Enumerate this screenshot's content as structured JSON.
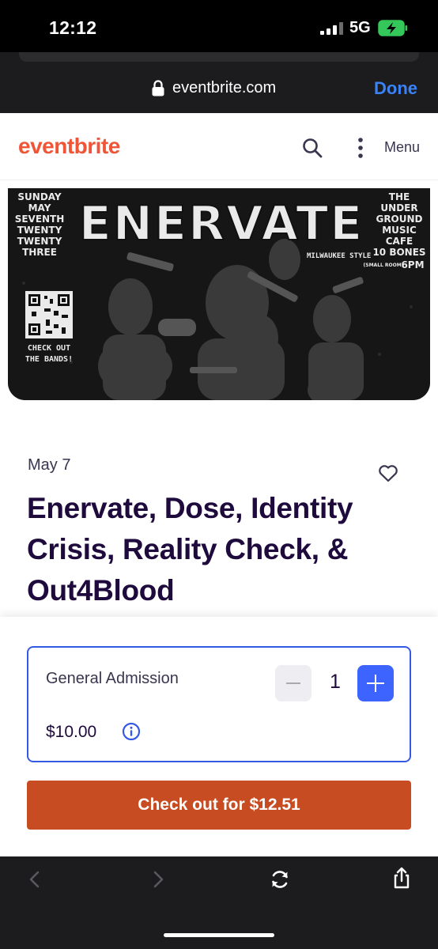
{
  "status_bar": {
    "time": "12:12",
    "network": "5G"
  },
  "safari": {
    "url": "eventbrite.com",
    "done_label": "Done"
  },
  "site_nav": {
    "logo": "eventbrite",
    "menu_label": "Menu"
  },
  "banner": {
    "headline": "ENERVATE",
    "left_text": [
      "SUNDAY",
      "MAY",
      "SEVENTH",
      "TWENTY",
      "TWENTY",
      "THREE"
    ],
    "right_text": [
      "THE",
      "UNDER",
      "GROUND",
      "MUSIC",
      "CAFE",
      "10 BONES",
      "(SMALL ROOM)",
      "6PM"
    ],
    "tagline": "MILWAUKEE STYLE",
    "qr_caption": [
      "CHECK OUT",
      "THE BANDS!"
    ]
  },
  "event": {
    "date": "May 7",
    "title_lines": [
      "Enervate, Dose, Identity",
      "Crisis, Reality Check, &",
      "Out4Blood"
    ]
  },
  "ticket": {
    "name": "General Admission",
    "price": "$10.00",
    "quantity": "1"
  },
  "checkout": {
    "label": "Check out for $12.51"
  },
  "colors": {
    "brand_orange": "#f05537",
    "checkout_button": "#c84c21",
    "accent_blue": "#3d64ff",
    "title_navy": "#1e0a3c",
    "safari_blue": "#3a82f7"
  },
  "icons": [
    "lock-icon",
    "search-icon",
    "kebab-icon",
    "heart-icon",
    "info-icon",
    "minus-icon",
    "plus-icon",
    "back-icon",
    "forward-icon",
    "reload-icon",
    "share-icon"
  ]
}
